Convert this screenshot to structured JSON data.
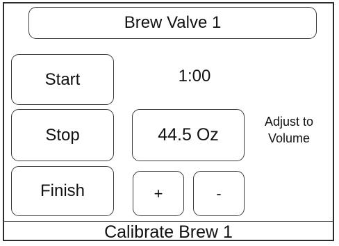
{
  "header": {
    "title": "Brew Valve 1"
  },
  "controls": {
    "start_label": "Start",
    "stop_label": "Stop",
    "finish_label": "Finish"
  },
  "timer": {
    "value": "1:00"
  },
  "volume": {
    "value": "44.5 Oz",
    "adjust_label_line1": "Adjust to",
    "adjust_label_line2": "Volume",
    "increment_label": "+",
    "decrement_label": "-"
  },
  "footer": {
    "title": "Calibrate Brew 1"
  }
}
